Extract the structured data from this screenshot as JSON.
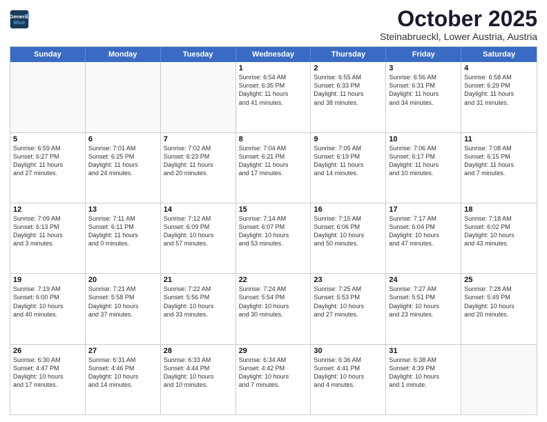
{
  "header": {
    "logo_line1": "General",
    "logo_line2": "Blue",
    "month_title": "October 2025",
    "location": "Steinabrueckl, Lower Austria, Austria"
  },
  "weekdays": [
    "Sunday",
    "Monday",
    "Tuesday",
    "Wednesday",
    "Thursday",
    "Friday",
    "Saturday"
  ],
  "rows": [
    [
      {
        "day": "",
        "info": ""
      },
      {
        "day": "",
        "info": ""
      },
      {
        "day": "",
        "info": ""
      },
      {
        "day": "1",
        "info": "Sunrise: 6:54 AM\nSunset: 6:35 PM\nDaylight: 11 hours\nand 41 minutes."
      },
      {
        "day": "2",
        "info": "Sunrise: 6:55 AM\nSunset: 6:33 PM\nDaylight: 11 hours\nand 38 minutes."
      },
      {
        "day": "3",
        "info": "Sunrise: 6:56 AM\nSunset: 6:31 PM\nDaylight: 11 hours\nand 34 minutes."
      },
      {
        "day": "4",
        "info": "Sunrise: 6:58 AM\nSunset: 6:29 PM\nDaylight: 11 hours\nand 31 minutes."
      }
    ],
    [
      {
        "day": "5",
        "info": "Sunrise: 6:59 AM\nSunset: 6:27 PM\nDaylight: 11 hours\nand 27 minutes."
      },
      {
        "day": "6",
        "info": "Sunrise: 7:01 AM\nSunset: 6:25 PM\nDaylight: 11 hours\nand 24 minutes."
      },
      {
        "day": "7",
        "info": "Sunrise: 7:02 AM\nSunset: 6:23 PM\nDaylight: 11 hours\nand 20 minutes."
      },
      {
        "day": "8",
        "info": "Sunrise: 7:04 AM\nSunset: 6:21 PM\nDaylight: 11 hours\nand 17 minutes."
      },
      {
        "day": "9",
        "info": "Sunrise: 7:05 AM\nSunset: 6:19 PM\nDaylight: 11 hours\nand 14 minutes."
      },
      {
        "day": "10",
        "info": "Sunrise: 7:06 AM\nSunset: 6:17 PM\nDaylight: 11 hours\nand 10 minutes."
      },
      {
        "day": "11",
        "info": "Sunrise: 7:08 AM\nSunset: 6:15 PM\nDaylight: 11 hours\nand 7 minutes."
      }
    ],
    [
      {
        "day": "12",
        "info": "Sunrise: 7:09 AM\nSunset: 6:13 PM\nDaylight: 11 hours\nand 3 minutes."
      },
      {
        "day": "13",
        "info": "Sunrise: 7:11 AM\nSunset: 6:11 PM\nDaylight: 11 hours\nand 0 minutes."
      },
      {
        "day": "14",
        "info": "Sunrise: 7:12 AM\nSunset: 6:09 PM\nDaylight: 10 hours\nand 57 minutes."
      },
      {
        "day": "15",
        "info": "Sunrise: 7:14 AM\nSunset: 6:07 PM\nDaylight: 10 hours\nand 53 minutes."
      },
      {
        "day": "16",
        "info": "Sunrise: 7:15 AM\nSunset: 6:06 PM\nDaylight: 10 hours\nand 50 minutes."
      },
      {
        "day": "17",
        "info": "Sunrise: 7:17 AM\nSunset: 6:04 PM\nDaylight: 10 hours\nand 47 minutes."
      },
      {
        "day": "18",
        "info": "Sunrise: 7:18 AM\nSunset: 6:02 PM\nDaylight: 10 hours\nand 43 minutes."
      }
    ],
    [
      {
        "day": "19",
        "info": "Sunrise: 7:19 AM\nSunset: 6:00 PM\nDaylight: 10 hours\nand 40 minutes."
      },
      {
        "day": "20",
        "info": "Sunrise: 7:21 AM\nSunset: 5:58 PM\nDaylight: 10 hours\nand 37 minutes."
      },
      {
        "day": "21",
        "info": "Sunrise: 7:22 AM\nSunset: 5:56 PM\nDaylight: 10 hours\nand 33 minutes."
      },
      {
        "day": "22",
        "info": "Sunrise: 7:24 AM\nSunset: 5:54 PM\nDaylight: 10 hours\nand 30 minutes."
      },
      {
        "day": "23",
        "info": "Sunrise: 7:25 AM\nSunset: 5:53 PM\nDaylight: 10 hours\nand 27 minutes."
      },
      {
        "day": "24",
        "info": "Sunrise: 7:27 AM\nSunset: 5:51 PM\nDaylight: 10 hours\nand 23 minutes."
      },
      {
        "day": "25",
        "info": "Sunrise: 7:28 AM\nSunset: 5:49 PM\nDaylight: 10 hours\nand 20 minutes."
      }
    ],
    [
      {
        "day": "26",
        "info": "Sunrise: 6:30 AM\nSunset: 4:47 PM\nDaylight: 10 hours\nand 17 minutes."
      },
      {
        "day": "27",
        "info": "Sunrise: 6:31 AM\nSunset: 4:46 PM\nDaylight: 10 hours\nand 14 minutes."
      },
      {
        "day": "28",
        "info": "Sunrise: 6:33 AM\nSunset: 4:44 PM\nDaylight: 10 hours\nand 10 minutes."
      },
      {
        "day": "29",
        "info": "Sunrise: 6:34 AM\nSunset: 4:42 PM\nDaylight: 10 hours\nand 7 minutes."
      },
      {
        "day": "30",
        "info": "Sunrise: 6:36 AM\nSunset: 4:41 PM\nDaylight: 10 hours\nand 4 minutes."
      },
      {
        "day": "31",
        "info": "Sunrise: 6:38 AM\nSunset: 4:39 PM\nDaylight: 10 hours\nand 1 minute."
      },
      {
        "day": "",
        "info": ""
      }
    ]
  ]
}
